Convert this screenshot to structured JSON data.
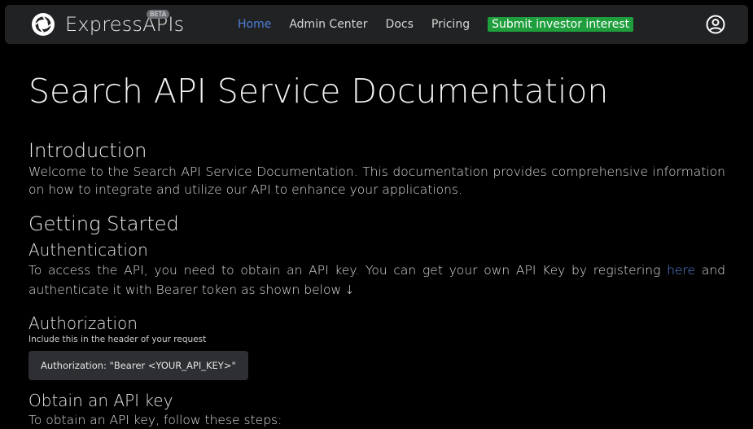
{
  "navbar": {
    "brand": "ExpressAPIs",
    "badge": "BETA",
    "items": [
      {
        "label": "Home",
        "active": true
      },
      {
        "label": "Admin Center",
        "active": false
      },
      {
        "label": "Docs",
        "active": false
      },
      {
        "label": "Pricing",
        "active": false
      }
    ],
    "cta_label": "Submit investor interest",
    "icons": {
      "logo": "aperture-logo-icon",
      "profile": "user-circle-icon"
    }
  },
  "main": {
    "title": "Search API Service Documentation",
    "intro": {
      "heading": "Introduction",
      "text": "Welcome to the Search API Service Documentation. This documentation provides comprehensive information on how to integrate and utilize our API to enhance your applications."
    },
    "getting_started": {
      "heading": "Getting Started",
      "auth": {
        "heading": "Authentication",
        "text_before": "To access the API, you need to obtain an API key. You can get your own API Key by registering ",
        "link_text": "here",
        "text_after": " and authenticate it with Bearer token as shown below",
        "arrow": "↓"
      },
      "authorization": {
        "heading": "Authorization",
        "subtext": "Include this in the header of your request",
        "code": "Authorization: \"Bearer <YOUR_API_KEY>\""
      },
      "obtain": {
        "heading": "Obtain an API key",
        "text": "To obtain an API key, follow these steps:"
      }
    }
  },
  "colors": {
    "accent": "#4d7fd8",
    "cta": "#1e9e3c",
    "navbar_bg": "#212224"
  }
}
